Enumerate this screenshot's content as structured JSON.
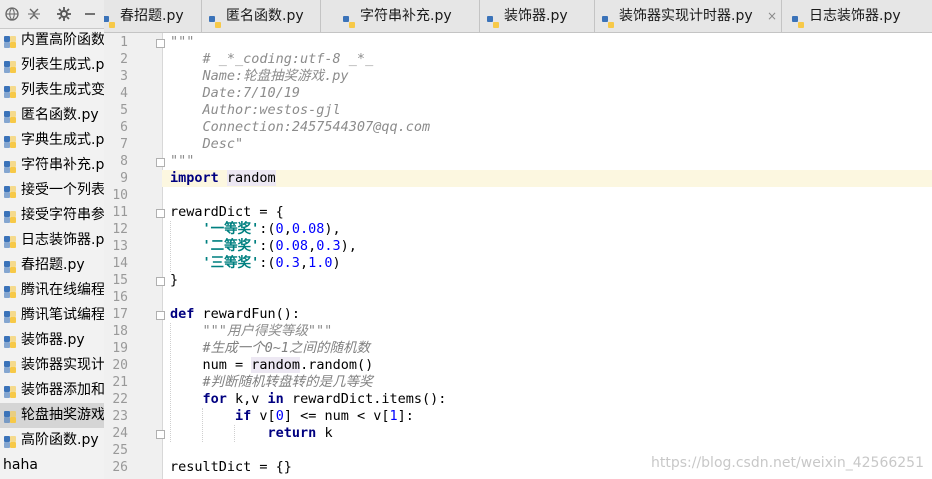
{
  "sidebar": {
    "toolbar_icons": [
      "globe-icon",
      "collapse-icon",
      "gear-icon",
      "hide-icon"
    ],
    "files": [
      {
        "label": "内置高阶函数.py"
      },
      {
        "label": "列表生成式.py"
      },
      {
        "label": "列表生成式变形.py"
      },
      {
        "label": "匿名函数.py"
      },
      {
        "label": "字典生成式.py"
      },
      {
        "label": "字符串补充.py"
      },
      {
        "label": "接受一个列表.py"
      },
      {
        "label": "接受字符串参数.py"
      },
      {
        "label": "日志装饰器.py"
      },
      {
        "label": "春招题.py"
      },
      {
        "label": "腾讯在线编程.py"
      },
      {
        "label": "腾讯笔试编程.py"
      },
      {
        "label": "装饰器.py"
      },
      {
        "label": "装饰器实现计时器.py"
      },
      {
        "label": "装饰器添加和.py"
      },
      {
        "label": "轮盘抽奖游戏.py",
        "selected": true
      },
      {
        "label": "高阶函数.py"
      }
    ],
    "folder": {
      "label": "haha"
    }
  },
  "tabs": [
    {
      "label": "春招题.py"
    },
    {
      "label": "匿名函数.py"
    },
    {
      "label": "字符串补充.py"
    },
    {
      "label": "装饰器.py"
    },
    {
      "label": "装饰器实现计时器.py"
    },
    {
      "label": "日志装饰器.py"
    }
  ],
  "tab_close_glyph": "×",
  "editor": {
    "current_line": 9,
    "lines": [
      {
        "n": "1",
        "text": "\"\"\""
      },
      {
        "n": "2",
        "text": "    # _*_coding:utf-8 _*_"
      },
      {
        "n": "3",
        "text": "    Name:轮盘抽奖游戏.py"
      },
      {
        "n": "4",
        "text": "    Date:7/10/19"
      },
      {
        "n": "5",
        "text": "    Author:westos-gjl"
      },
      {
        "n": "6",
        "text": "    Connection:2457544307@qq.com"
      },
      {
        "n": "7",
        "text": "    Desc\""
      },
      {
        "n": "8",
        "text": "\"\"\""
      },
      {
        "n": "9",
        "text": "import random"
      },
      {
        "n": "10",
        "text": ""
      },
      {
        "n": "11",
        "text": "rewardDict = {"
      },
      {
        "n": "12",
        "text": "    '一等奖':(0,0.08),"
      },
      {
        "n": "13",
        "text": "    '二等奖':(0.08,0.3),"
      },
      {
        "n": "14",
        "text": "    '三等奖':(0.3,1.0)"
      },
      {
        "n": "15",
        "text": "}"
      },
      {
        "n": "16",
        "text": ""
      },
      {
        "n": "17",
        "text": "def rewardFun():"
      },
      {
        "n": "18",
        "text": "    \"\"\"用户得奖等级\"\"\""
      },
      {
        "n": "19",
        "text": "    #生成一个0~1之间的随机数"
      },
      {
        "n": "20",
        "text": "    num = random.random()"
      },
      {
        "n": "21",
        "text": "    #判断随机转盘转的是几等奖"
      },
      {
        "n": "22",
        "text": "    for k,v in rewardDict.items():"
      },
      {
        "n": "23",
        "text": "        if v[0] <= num < v[1]:"
      },
      {
        "n": "24",
        "text": "            return k"
      },
      {
        "n": "25",
        "text": ""
      },
      {
        "n": "26",
        "text": "resultDict = {}"
      }
    ]
  },
  "watermark": "https://blog.csdn.net/weixin_42566251",
  "colors": {
    "keyword": "#000080",
    "string": "#008080",
    "number": "#0000ff",
    "comment": "#808080",
    "docstring": "#8c8c8c",
    "current_line_bg": "#fcf7e0",
    "selected_file_bg": "#d5d5d5"
  }
}
